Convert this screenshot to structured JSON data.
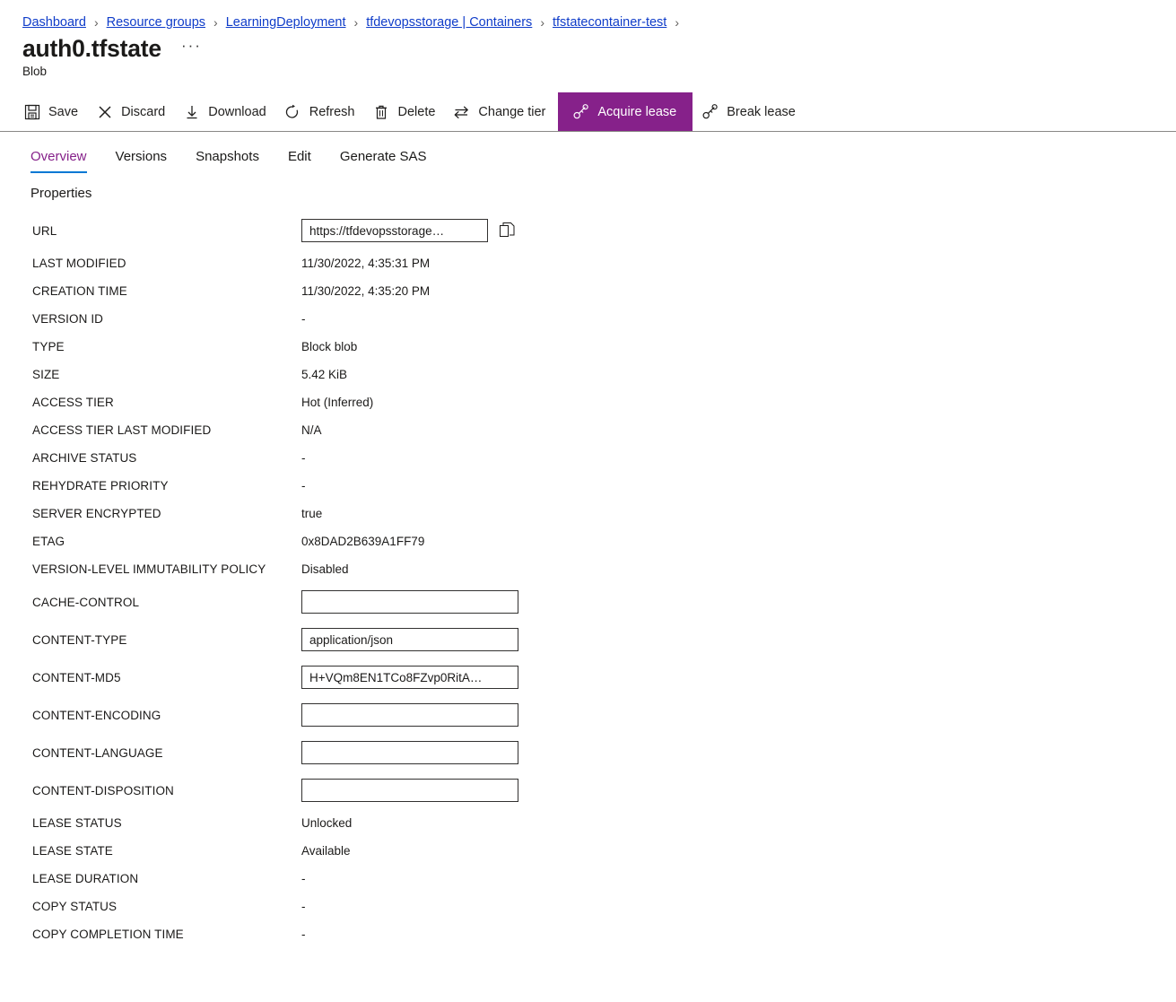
{
  "breadcrumb": {
    "items": [
      {
        "label": "Dashboard"
      },
      {
        "label": "Resource groups"
      },
      {
        "label": "LearningDeployment"
      },
      {
        "label": "tfdevopsstorage | Containers"
      },
      {
        "label": "tfstatecontainer-test"
      }
    ],
    "separator": "›"
  },
  "header": {
    "title": "auth0.tfstate",
    "ellipsis": "···",
    "subtitle": "Blob"
  },
  "toolbar": {
    "active_color": "#86218a",
    "commands": [
      {
        "label": "Save",
        "icon": "save-icon",
        "active": false
      },
      {
        "label": "Discard",
        "icon": "discard-icon",
        "active": false
      },
      {
        "label": "Download",
        "icon": "download-icon",
        "active": false
      },
      {
        "label": "Refresh",
        "icon": "refresh-icon",
        "active": false
      },
      {
        "label": "Delete",
        "icon": "delete-icon",
        "active": false
      },
      {
        "label": "Change tier",
        "icon": "change-tier-icon",
        "active": false
      },
      {
        "label": "Acquire lease",
        "icon": "lease-icon",
        "active": true
      },
      {
        "label": "Break lease",
        "icon": "lease-icon",
        "active": false
      }
    ]
  },
  "tabs": {
    "selected_color": "#86218a",
    "underline_color": "#0078d4",
    "items": [
      {
        "label": "Overview",
        "selected": true
      },
      {
        "label": "Versions",
        "selected": false
      },
      {
        "label": "Snapshots",
        "selected": false
      },
      {
        "label": "Edit",
        "selected": false
      },
      {
        "label": "Generate SAS",
        "selected": false
      }
    ]
  },
  "properties": {
    "section_title": "Properties",
    "url": {
      "label": "URL",
      "value": "https://tfdevopsstorage…",
      "copy_icon": "copy-icon"
    },
    "rows": [
      {
        "label": "LAST MODIFIED",
        "value": "11/30/2022, 4:35:31 PM"
      },
      {
        "label": "CREATION TIME",
        "value": "11/30/2022, 4:35:20 PM"
      },
      {
        "label": "VERSION ID",
        "value": "-"
      },
      {
        "label": "TYPE",
        "value": "Block blob"
      },
      {
        "label": "SIZE",
        "value": "5.42 KiB"
      },
      {
        "label": "ACCESS TIER",
        "value": "Hot (Inferred)"
      },
      {
        "label": "ACCESS TIER LAST MODIFIED",
        "value": "N/A"
      },
      {
        "label": "ARCHIVE STATUS",
        "value": "-"
      },
      {
        "label": "REHYDRATE PRIORITY",
        "value": "-"
      },
      {
        "label": "SERVER ENCRYPTED",
        "value": "true"
      },
      {
        "label": "ETAG",
        "value": "0x8DAD2B639A1FF79"
      },
      {
        "label": "VERSION-LEVEL IMMUTABILITY POLICY",
        "value": "Disabled"
      }
    ],
    "input_rows": [
      {
        "label": "CACHE-CONTROL",
        "value": "",
        "placeholder": ""
      },
      {
        "label": "CONTENT-TYPE",
        "value": "application/json",
        "placeholder": ""
      },
      {
        "label": "CONTENT-MD5",
        "value": "H+VQm8EN1TCo8FZvp0RitA…",
        "placeholder": ""
      },
      {
        "label": "CONTENT-ENCODING",
        "value": "",
        "placeholder": ""
      },
      {
        "label": "CONTENT-LANGUAGE",
        "value": "",
        "placeholder": ""
      },
      {
        "label": "CONTENT-DISPOSITION",
        "value": "",
        "placeholder": ""
      }
    ],
    "lease_rows": [
      {
        "label": "LEASE STATUS",
        "value": "Unlocked"
      },
      {
        "label": "LEASE STATE",
        "value": "Available"
      },
      {
        "label": "LEASE DURATION",
        "value": "-"
      },
      {
        "label": "COPY STATUS",
        "value": "-"
      },
      {
        "label": "COPY COMPLETION TIME",
        "value": "-"
      }
    ]
  }
}
